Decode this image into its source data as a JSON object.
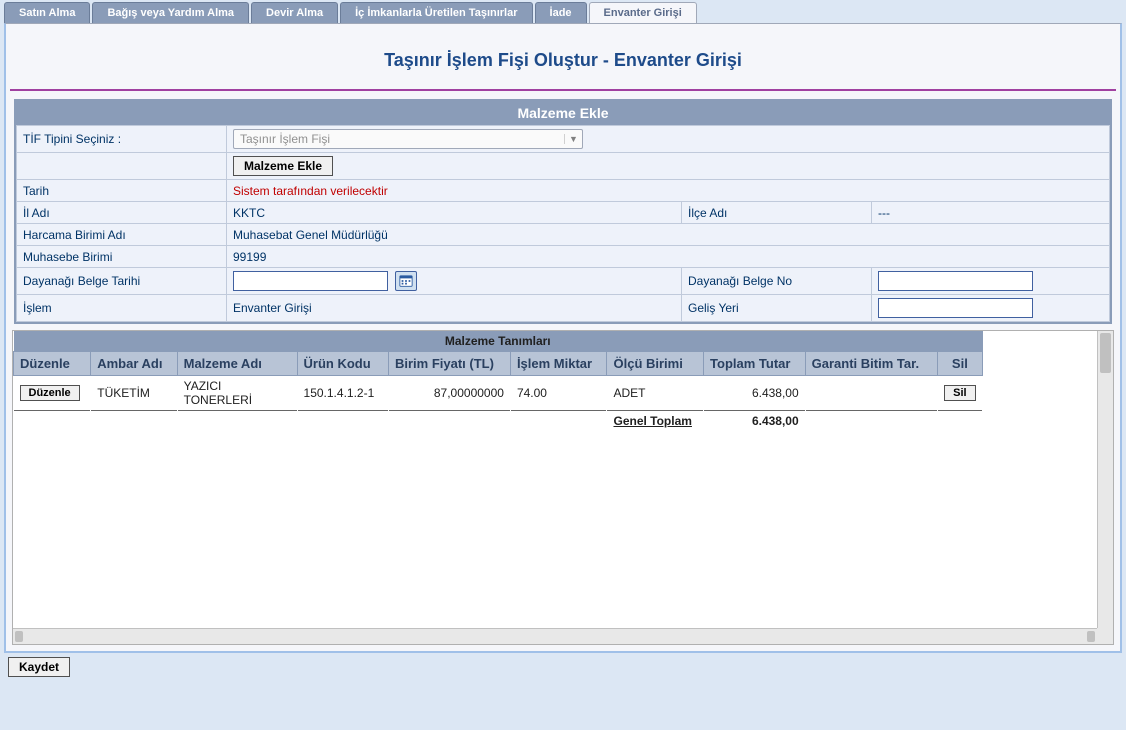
{
  "tabs": [
    {
      "label": "Satın Alma"
    },
    {
      "label": "Bağış veya Yardım Alma"
    },
    {
      "label": "Devir Alma"
    },
    {
      "label": "İç İmkanlarla Üretilen Taşınırlar"
    },
    {
      "label": "İade"
    },
    {
      "label": "Envanter Girişi"
    }
  ],
  "page_title": "Taşınır İşlem Fişi Oluştur - Envanter Girişi",
  "section_malzeme": {
    "header": "Malzeme Ekle",
    "tif_label": "TİF Tipini Seçiniz :",
    "tif_value": "Taşınır İşlem Fişi",
    "add_btn": "Malzeme Ekle",
    "tarih_label": "Tarih",
    "tarih_value": "Sistem tarafından verilecektir",
    "il_label": "İl Adı",
    "il_value": "KKTC",
    "ilce_label": "İlçe Adı",
    "ilce_value": "---",
    "harcama_label": "Harcama Birimi Adı",
    "harcama_value": "Muhasebat Genel Müdürlüğü",
    "muhasebe_label": "Muhasebe Birimi",
    "muhasebe_value": "99199",
    "dayanagi_tarih_label": "Dayanağı Belge Tarihi",
    "dayanagi_no_label": "Dayanağı Belge No",
    "islem_label": "İşlem",
    "islem_value": "Envanter Girişi",
    "gelis_label": "Geliş Yeri"
  },
  "grid": {
    "title": "Malzeme Tanımları",
    "headers": {
      "duzenle": "Düzenle",
      "ambar": "Ambar Adı",
      "malzeme": "Malzeme Adı",
      "urun": "Ürün Kodu",
      "birim_fiyat": "Birim Fiyatı (TL)",
      "miktar": "İşlem Miktar",
      "olcu": "Ölçü Birimi",
      "toplam": "Toplam Tutar",
      "garanti": "Garanti Bitim Tar.",
      "sil": "Sil"
    },
    "row": {
      "duzenle_btn": "Düzenle",
      "ambar": "TÜKETİM",
      "malzeme": "YAZICI TONERLERİ",
      "urun": "150.1.4.1.2-1",
      "birim_fiyat": "87,00000000",
      "miktar": "74.00",
      "olcu": "ADET",
      "toplam": "6.438,00",
      "garanti": "",
      "sil_btn": "Sil"
    },
    "sum_label": "Genel Toplam",
    "sum_value": "6.438,00"
  },
  "save_btn": "Kaydet"
}
